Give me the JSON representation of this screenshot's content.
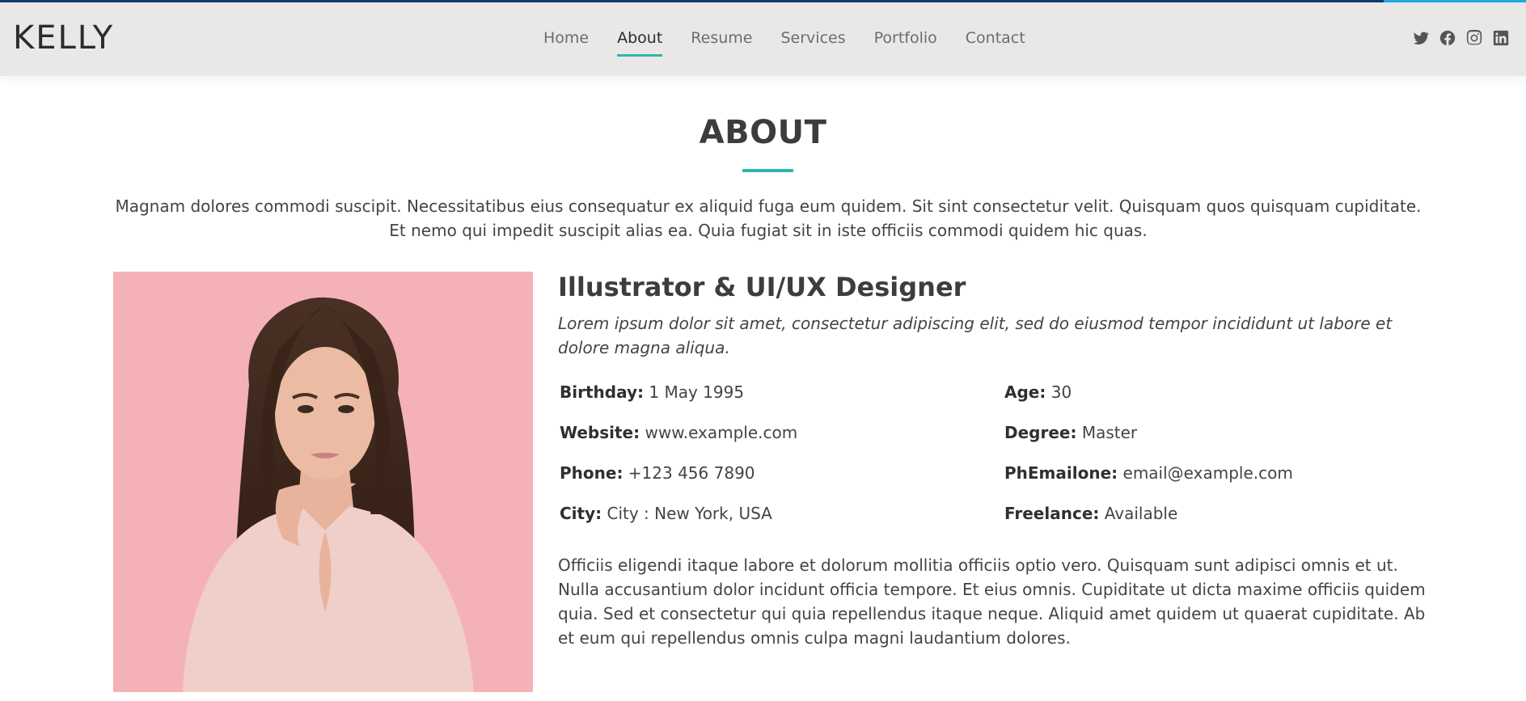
{
  "header": {
    "logo": "KELLY",
    "nav": [
      {
        "label": "Home",
        "active": false
      },
      {
        "label": "About",
        "active": true
      },
      {
        "label": "Resume",
        "active": false
      },
      {
        "label": "Services",
        "active": false
      },
      {
        "label": "Portfolio",
        "active": false
      },
      {
        "label": "Contact",
        "active": false
      }
    ],
    "social_icons": [
      "twitter-icon",
      "facebook-icon",
      "instagram-icon",
      "linkedin-icon"
    ]
  },
  "about": {
    "title": "ABOUT",
    "intro": "Magnam dolores commodi suscipit. Necessitatibus eius consequatur ex aliquid fuga eum quidem. Sit sint consectetur velit. Quisquam quos quisquam cupiditate. Et nemo qui impedit suscipit alias ea. Quia fugiat sit in iste officiis commodi quidem hic quas.",
    "role": "Illustrator & UI/UX Designer",
    "lead": "Lorem ipsum dolor sit amet, consectetur adipiscing elit, sed do eiusmod tempor incididunt ut labore et dolore magna aliqua.",
    "info_left": [
      {
        "label": "Birthday:",
        "value": "1 May 1995"
      },
      {
        "label": "Website:",
        "value": "www.example.com"
      },
      {
        "label": "Phone:",
        "value": "+123 456 7890"
      },
      {
        "label": "City:",
        "value": "City : New York, USA"
      }
    ],
    "info_right": [
      {
        "label": "Age:",
        "value": "30"
      },
      {
        "label": "Degree:",
        "value": "Master"
      },
      {
        "label": "PhEmailone:",
        "value": "email@example.com"
      },
      {
        "label": "Freelance:",
        "value": "Available"
      }
    ],
    "description": "Officiis eligendi itaque labore et dolorum mollitia officiis optio vero. Quisquam sunt adipisci omnis et ut. Nulla accusantium dolor incidunt officia tempore. Et eius omnis. Cupiditate ut dicta maxime officiis quidem quia. Sed et consectetur qui quia repellendus itaque neque. Aliquid amet quidem ut quaerat cupiditate. Ab et eum qui repellendus omnis culpa magni laudantium dolores."
  },
  "colors": {
    "accent": "#2fb7aa",
    "header_bg": "#e9e8e6",
    "top_line": "#0f3a6e",
    "top_line_highlight": "#1ea7e1",
    "photo_bg": "#f6b6bb"
  }
}
